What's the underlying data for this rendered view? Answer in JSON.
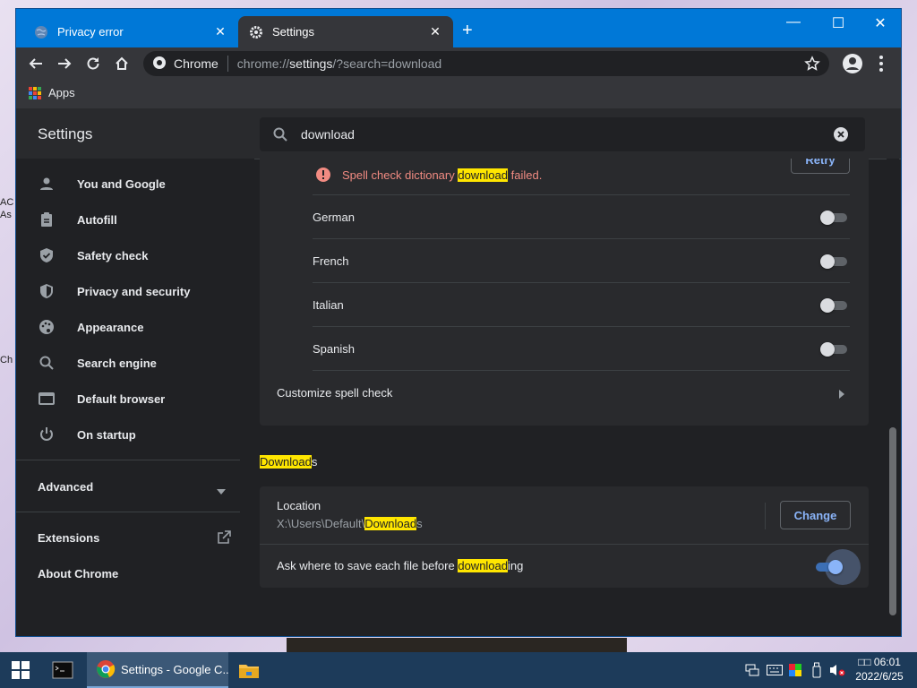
{
  "desktop": {
    "edge_text_1": "AC",
    "edge_text_2": "As",
    "edge_text_3": "Ch"
  },
  "browser": {
    "tabs": [
      {
        "label": "Privacy error",
        "icon": "globe-icon"
      },
      {
        "label": "Settings",
        "icon": "gear-icon"
      }
    ],
    "window_controls": [
      "minimize",
      "maximize",
      "close"
    ],
    "omnibox": {
      "chip": "Chrome",
      "url_scheme": "chrome://",
      "url_host": "settings",
      "url_path": "/?search=download"
    },
    "bookmarks": {
      "apps_label": "Apps"
    }
  },
  "settings": {
    "title": "Settings",
    "search_value": "download",
    "sidebar": {
      "items": [
        {
          "label": "You and Google",
          "icon": "person-icon"
        },
        {
          "label": "Autofill",
          "icon": "clipboard-icon"
        },
        {
          "label": "Safety check",
          "icon": "shield-check-icon"
        },
        {
          "label": "Privacy and security",
          "icon": "shield-icon"
        },
        {
          "label": "Appearance",
          "icon": "palette-icon"
        },
        {
          "label": "Search engine",
          "icon": "search-icon"
        },
        {
          "label": "Default browser",
          "icon": "browser-window-icon"
        },
        {
          "label": "On startup",
          "icon": "power-icon"
        }
      ],
      "advanced": "Advanced",
      "extensions": "Extensions",
      "about": "About Chrome"
    },
    "spellcheck": {
      "error_before": "Spell check dictionary ",
      "error_highlight": "download",
      "error_after": " failed.",
      "retry": "Retry",
      "languages": [
        {
          "name": "German",
          "enabled": false
        },
        {
          "name": "French",
          "enabled": false
        },
        {
          "name": "Italian",
          "enabled": false
        },
        {
          "name": "Spanish",
          "enabled": false
        }
      ],
      "customize": "Customize spell check"
    },
    "downloads": {
      "heading_highlight": "Download",
      "heading_rest": "s",
      "location_label": "Location",
      "location_path_before": "X:\\Users\\Default\\",
      "location_path_highlight": "Download",
      "location_path_after": "s",
      "change": "Change",
      "ask_before": "Ask where to save each file before ",
      "ask_highlight": "download",
      "ask_after": "ing",
      "ask_enabled": true
    }
  },
  "taskbar": {
    "chrome_label": "Settings - Google C...",
    "time": "□□ 06:01",
    "date": "2022/6/25"
  },
  "colors": {
    "titlebar": "#0078d7",
    "highlight": "#ffe600",
    "link_blue": "#8ab4f8",
    "error_red": "#f28b82"
  }
}
